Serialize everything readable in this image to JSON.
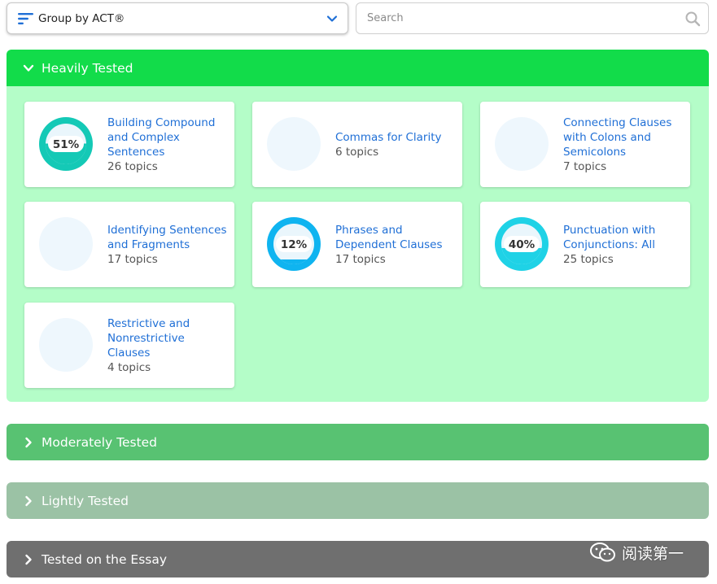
{
  "toolbar": {
    "group_label": "Group by ACT®",
    "search_placeholder": "Search"
  },
  "colors": {
    "accent_blue": "#1f6fd6",
    "heavy": "#12dc4a",
    "heavy_bg": "#b4fdc8",
    "moderate": "#58c272",
    "light": "#9bc2a5",
    "essay": "#6f6f6f",
    "ring_teal": "#14c9b6",
    "ring_blue": "#0fb4f0",
    "ring_cyan": "#1fd2e6"
  },
  "sections": {
    "heavy": {
      "label": "Heavily Tested",
      "expanded": true
    },
    "moderate": {
      "label": "Moderately Tested",
      "expanded": false
    },
    "light": {
      "label": "Lightly Tested",
      "expanded": false
    },
    "essay": {
      "label": "Tested on the Essay",
      "expanded": false
    }
  },
  "cards": [
    {
      "title": "Building Compound and Complex Sentences",
      "topics": "26 topics",
      "percent_label": "51%",
      "percent": 51,
      "color": "#14c9b6"
    },
    {
      "title": "Commas for Clarity",
      "topics": "6 topics",
      "percent_label": "",
      "percent": null,
      "color": ""
    },
    {
      "title": "Connecting Clauses with Colons and Semicolons",
      "topics": "7 topics",
      "percent_label": "",
      "percent": null,
      "color": ""
    },
    {
      "title": "Identifying Sentences and Fragments",
      "topics": "17 topics",
      "percent_label": "",
      "percent": null,
      "color": ""
    },
    {
      "title": "Phrases and Dependent Clauses",
      "topics": "17 topics",
      "percent_label": "12%",
      "percent": 12,
      "color": "#0fb4f0"
    },
    {
      "title": "Punctuation with Conjunctions: All",
      "topics": "25 topics",
      "percent_label": "40%",
      "percent": 40,
      "color": "#1fd2e6"
    },
    {
      "title": "Restrictive and Nonrestrictive Clauses",
      "topics": "4 topics",
      "percent_label": "",
      "percent": null,
      "color": ""
    }
  ],
  "watermark": {
    "text": "阅读第一"
  }
}
